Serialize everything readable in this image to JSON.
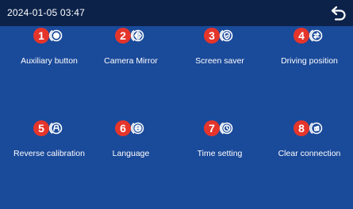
{
  "status_bar": {
    "datetime": "2024-01-05  03:47",
    "back_icon": "back-arrow-icon"
  },
  "colors": {
    "background": "#1a4a9a",
    "topbar": "#0c2249",
    "badge": "#e5352b",
    "text": "#ffffff"
  },
  "menu": {
    "items": [
      {
        "number": "1",
        "label": "Auxiliary button",
        "icon": "auxiliary-button-icon"
      },
      {
        "number": "2",
        "label": "Camera Mirror",
        "icon": "camera-mirror-icon"
      },
      {
        "number": "3",
        "label": "Screen saver",
        "icon": "screen-saver-icon"
      },
      {
        "number": "4",
        "label": "Driving position",
        "icon": "driving-position-icon"
      },
      {
        "number": "5",
        "label": "Reverse calibration",
        "icon": "reverse-calibration-icon"
      },
      {
        "number": "6",
        "label": "Language",
        "icon": "language-icon"
      },
      {
        "number": "7",
        "label": "Time setting",
        "icon": "time-setting-icon"
      },
      {
        "number": "8",
        "label": "Clear connection",
        "icon": "clear-connection-icon"
      }
    ]
  }
}
